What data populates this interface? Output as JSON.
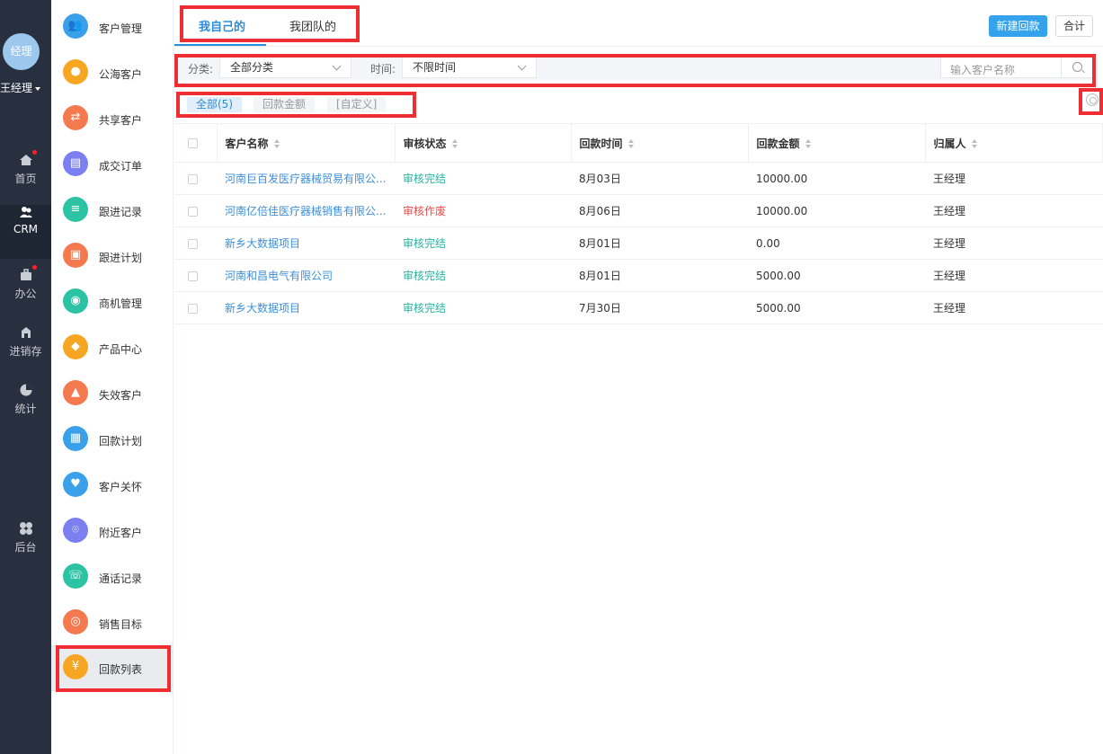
{
  "user": {
    "avatar_text": "经理",
    "name": "王经理"
  },
  "rail": {
    "items": [
      {
        "label": "首页",
        "icon": "home-icon",
        "has_dot": true
      },
      {
        "label": "CRM",
        "icon": "crm-users-icon",
        "active": true
      },
      {
        "label": "办公",
        "icon": "briefcase-icon",
        "has_dot": true
      },
      {
        "label": "进销存",
        "icon": "inventory-icon"
      },
      {
        "label": "统计",
        "icon": "pie-chart-icon"
      },
      {
        "label": "后台",
        "icon": "grid-apps-icon"
      }
    ]
  },
  "sidebar": {
    "items": [
      {
        "label": "客户管理",
        "icon": "customer-icon",
        "color": "#3aa0ea"
      },
      {
        "label": "公海客户",
        "icon": "user-icon",
        "color": "#f6a623"
      },
      {
        "label": "共享客户",
        "icon": "share-user-icon",
        "color": "#f4794f"
      },
      {
        "label": "成交订单",
        "icon": "order-icon",
        "color": "#7b7ff0"
      },
      {
        "label": "跟进记录",
        "icon": "record-icon",
        "color": "#2cc3a4"
      },
      {
        "label": "跟进计划",
        "icon": "plan-icon",
        "color": "#f4794f"
      },
      {
        "label": "商机管理",
        "icon": "bulb-icon",
        "color": "#2cc3a4"
      },
      {
        "label": "产品中心",
        "icon": "box-icon",
        "color": "#f6a623"
      },
      {
        "label": "失效客户",
        "icon": "warning-icon",
        "color": "#f4794f"
      },
      {
        "label": "回款计划",
        "icon": "payment-plan-icon",
        "color": "#3aa0ea"
      },
      {
        "label": "客户关怀",
        "icon": "care-icon",
        "color": "#3aa0ea"
      },
      {
        "label": "附近客户",
        "icon": "location-icon",
        "color": "#7b7ff0"
      },
      {
        "label": "通话记录",
        "icon": "phone-icon",
        "color": "#2cc3a4"
      },
      {
        "label": "销售目标",
        "icon": "target-icon",
        "color": "#f4794f"
      },
      {
        "label": "回款列表",
        "icon": "payment-list-icon",
        "color": "#f6a623",
        "active": true
      }
    ]
  },
  "tabs": {
    "mine": "我自己的",
    "team": "我团队的"
  },
  "buttons": {
    "new_payment": "新建回款",
    "total": "合计"
  },
  "filters": {
    "category_label": "分类:",
    "category_value": "全部分类",
    "time_label": "时间:",
    "time_value": "不限时间",
    "search_placeholder": "输入客户名称"
  },
  "subtabs": {
    "all": "全部(5)",
    "amount": "回款金额",
    "custom": "[自定义]"
  },
  "table": {
    "headers": [
      "客户名称",
      "审核状态",
      "回款时间",
      "回款金额",
      "归属人"
    ],
    "rows": [
      {
        "customer": "河南巨百发医疗器械贸易有限公...",
        "status": "审核完结",
        "status_type": "ok",
        "date": "8月03日",
        "amount": "10000.00",
        "owner": "王经理"
      },
      {
        "customer": "河南亿倍佳医疗器械销售有限公...",
        "status": "审核作废",
        "status_type": "void",
        "date": "8月06日",
        "amount": "10000.00",
        "owner": "王经理"
      },
      {
        "customer": "新乡大数据项目",
        "status": "审核完结",
        "status_type": "ok",
        "date": "8月01日",
        "amount": "0.00",
        "owner": "王经理"
      },
      {
        "customer": "河南和昌电气有限公司",
        "status": "审核完结",
        "status_type": "ok",
        "date": "8月01日",
        "amount": "5000.00",
        "owner": "王经理"
      },
      {
        "customer": "新乡大数据项目",
        "status": "审核完结",
        "status_type": "ok",
        "date": "7月30日",
        "amount": "5000.00",
        "owner": "王经理"
      }
    ]
  },
  "colors": {
    "accent": "#35a2ec",
    "status_ok": "#26b3a0",
    "status_void": "#f04b4b",
    "highlight_box": "#ef2e34"
  }
}
